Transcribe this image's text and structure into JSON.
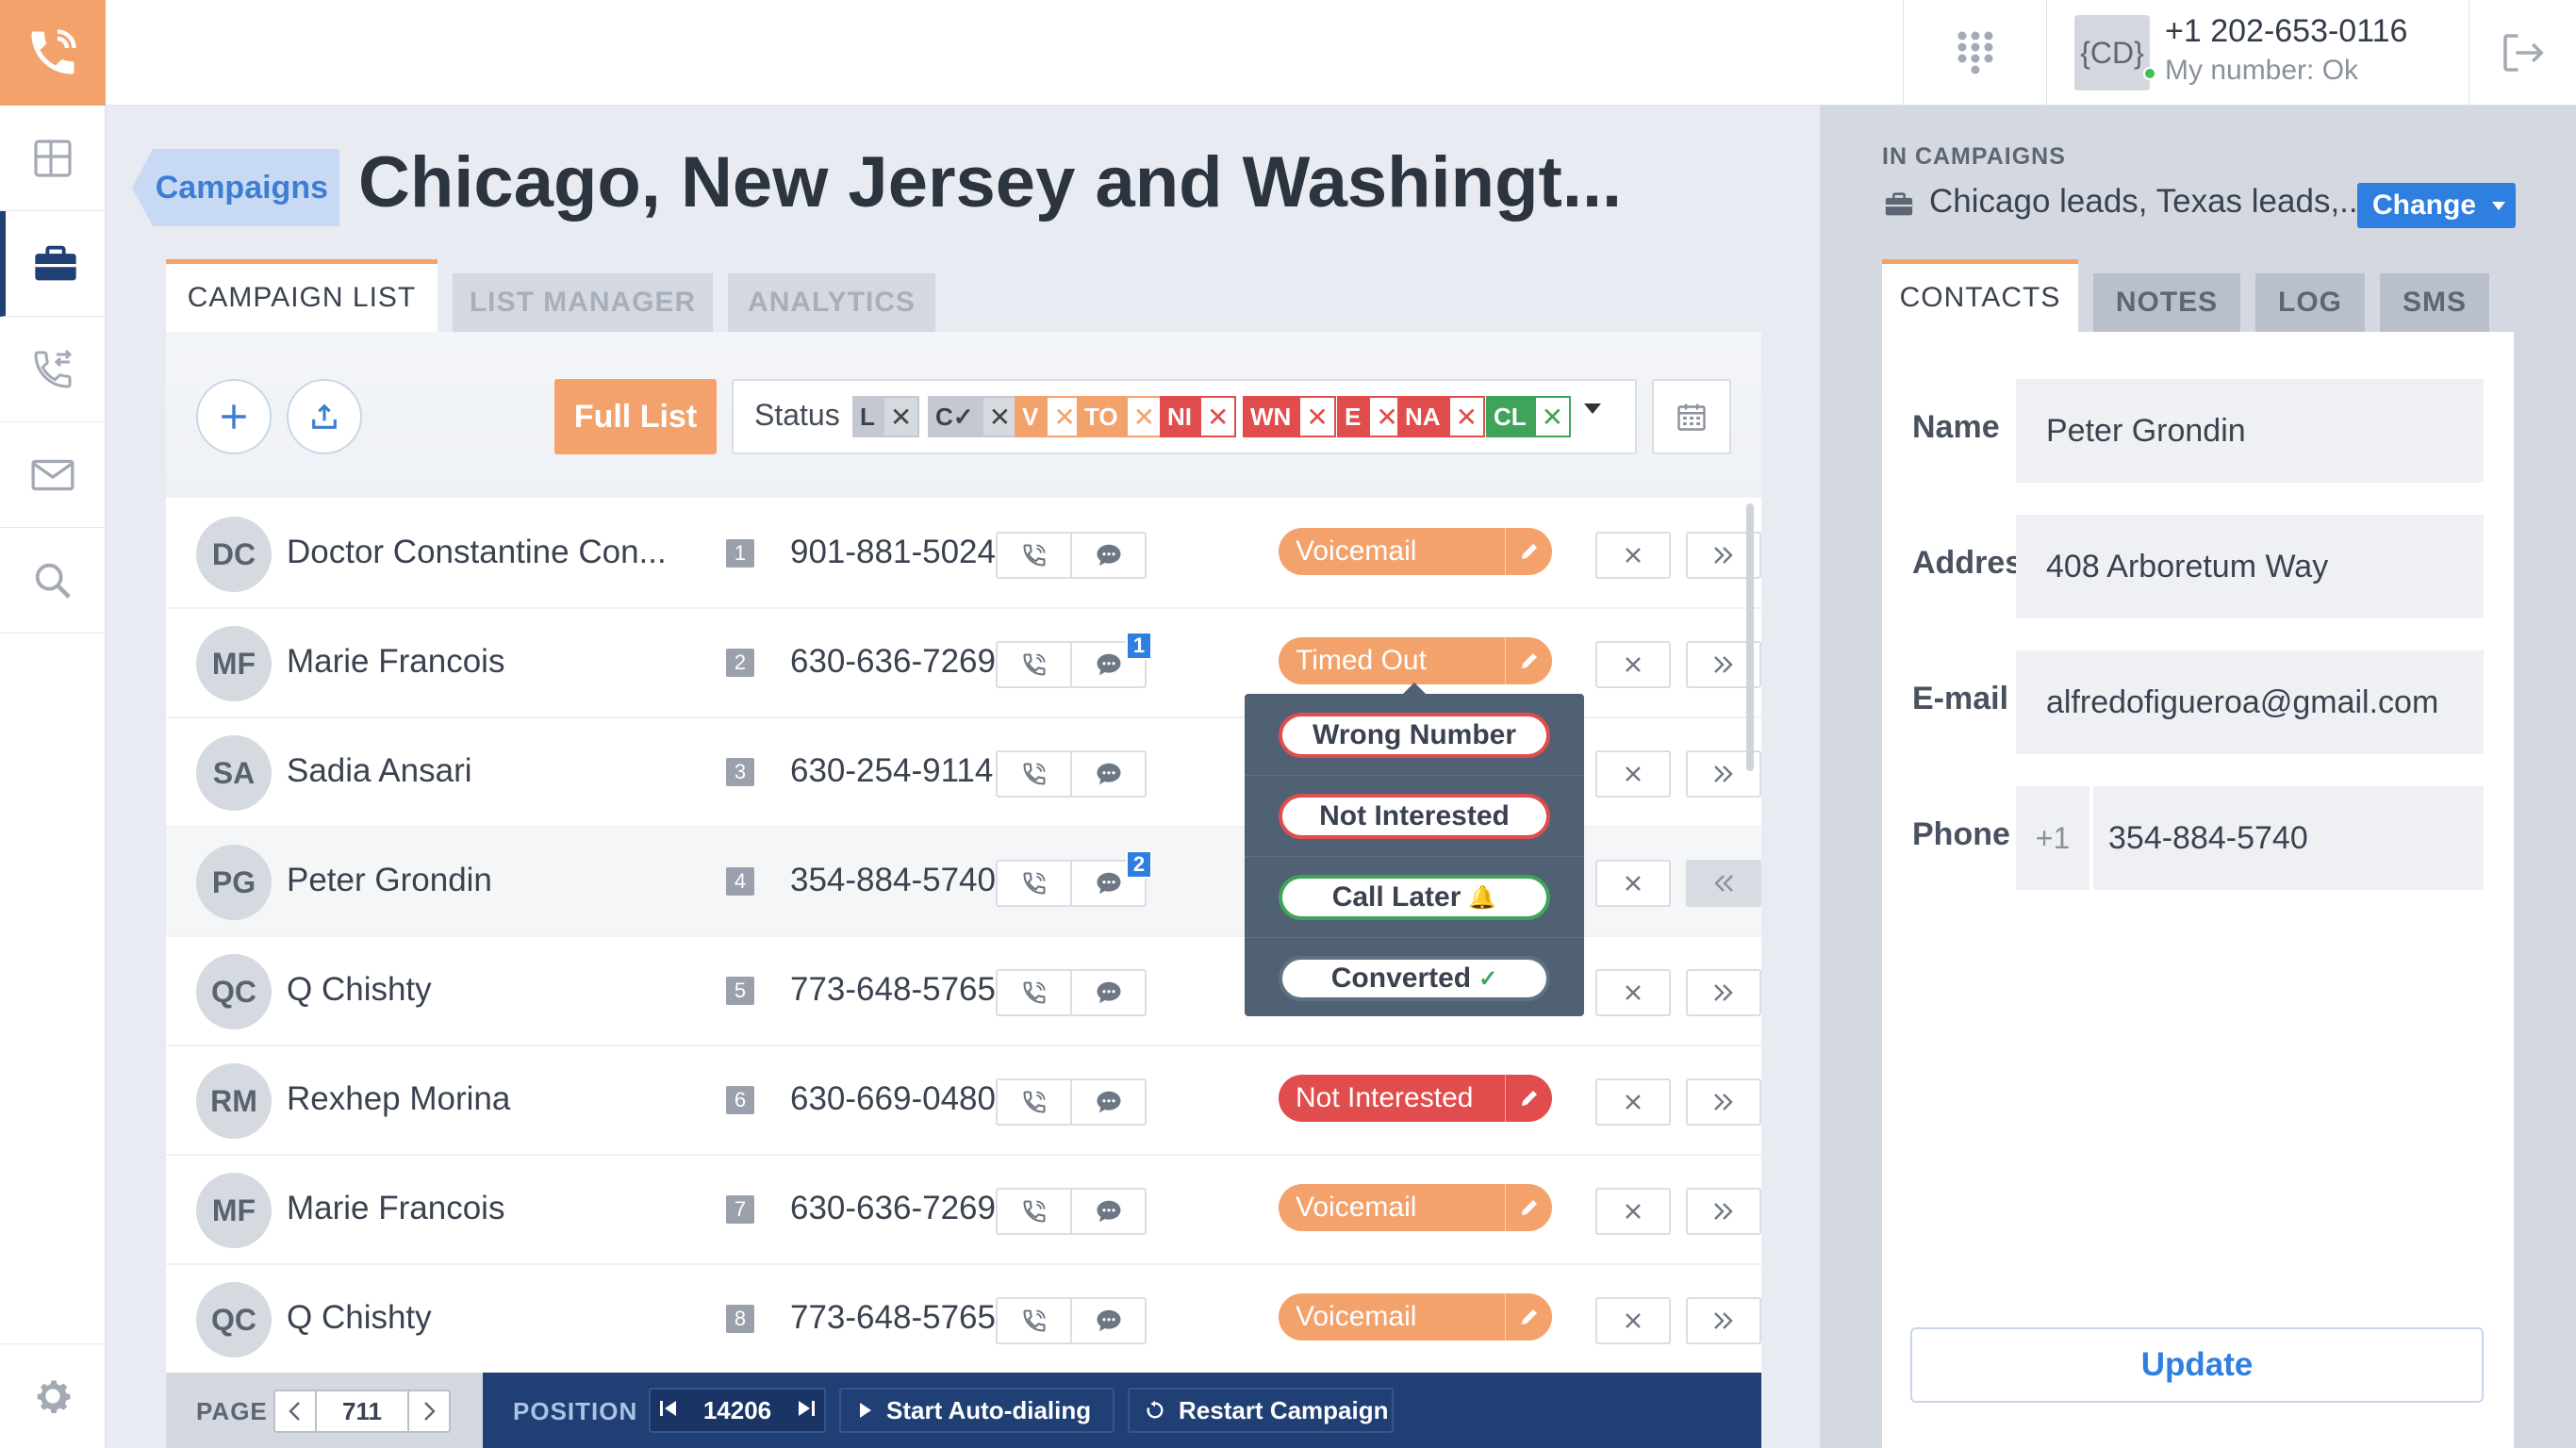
{
  "topbar": {
    "avatar_initials": "{CD}",
    "my_number": "+1 202-653-0116",
    "number_status": "My number: Ok"
  },
  "header": {
    "breadcrumb": "Campaigns",
    "title": "Chicago, New Jersey and Washingt..."
  },
  "tabs": [
    "CAMPAIGN LIST",
    "LIST MANAGER",
    "ANALYTICS"
  ],
  "toolbar": {
    "full_list": "Full List",
    "status_label": "Status"
  },
  "status_chips": [
    {
      "code": "L",
      "bg": "#c4c9d1",
      "color": "#3a4250"
    },
    {
      "code": "C✓",
      "bg": "#c4c9d1",
      "color": "#3a4250"
    },
    {
      "code": "V",
      "bg": "#f4a26c",
      "color": "#ffffff"
    },
    {
      "code": "TO",
      "bg": "#f4a26c",
      "color": "#ffffff"
    },
    {
      "code": "NI",
      "bg": "#e14c4c",
      "color": "#ffffff"
    },
    {
      "code": "WN",
      "bg": "#e14c4c",
      "color": "#ffffff"
    },
    {
      "code": "E",
      "bg": "#e14c4c",
      "color": "#ffffff"
    },
    {
      "code": "NA",
      "bg": "#e14c4c",
      "color": "#ffffff"
    },
    {
      "code": "CL",
      "bg": "#3fa45a",
      "color": "#ffffff"
    }
  ],
  "contacts": [
    {
      "initials": "DC",
      "name": "Doctor Constantine Con...",
      "num": "1",
      "phone": "901-881-5024",
      "status": "Voicemail",
      "status_color": "#f4a26c",
      "badge": "",
      "highlight": false
    },
    {
      "initials": "MF",
      "name": "Marie Francois",
      "num": "2",
      "phone": "630-636-7269",
      "status": "Timed Out",
      "status_color": "#f4a26c",
      "badge": "1",
      "highlight": false
    },
    {
      "initials": "SA",
      "name": "Sadia Ansari",
      "num": "3",
      "phone": "630-254-9114",
      "status": "",
      "status_color": "",
      "badge": "",
      "highlight": false
    },
    {
      "initials": "PG",
      "name": "Peter Grondin",
      "num": "4",
      "phone": "354-884-5740",
      "status": "",
      "status_color": "",
      "badge": "2",
      "highlight": true
    },
    {
      "initials": "QC",
      "name": "Q Chishty",
      "num": "5",
      "phone": "773-648-5765",
      "status": "",
      "status_color": "",
      "badge": "",
      "highlight": false
    },
    {
      "initials": "RM",
      "name": "Rexhep Morina",
      "num": "6",
      "phone": "630-669-0480",
      "status": "Not Interested",
      "status_color": "#e14c4c",
      "badge": "",
      "highlight": false
    },
    {
      "initials": "MF",
      "name": "Marie Francois",
      "num": "7",
      "phone": "630-636-7269",
      "status": "Voicemail",
      "status_color": "#f4a26c",
      "badge": "",
      "highlight": false
    },
    {
      "initials": "QC",
      "name": "Q Chishty",
      "num": "8",
      "phone": "773-648-5765",
      "status": "Voicemail",
      "status_color": "#f4a26c",
      "badge": "",
      "highlight": false
    }
  ],
  "status_menu": [
    {
      "label": "Wrong Number",
      "border": "#e14c4c",
      "suffix": ""
    },
    {
      "label": "Not Interested",
      "border": "#e14c4c",
      "suffix": ""
    },
    {
      "label": "Call Later",
      "border": "#3fa45a",
      "suffix": "🔔"
    },
    {
      "label": "Converted",
      "border": "#5f7182",
      "suffix": "✓"
    }
  ],
  "pager": {
    "page_label": "PAGE",
    "page": "711",
    "position_label": "POSITION",
    "position": "14206",
    "start_label": "Start Auto-dialing",
    "restart_label": "Restart Campaign"
  },
  "right": {
    "in_campaigns_label": "IN CAMPAIGNS",
    "in_campaigns": "Chicago leads, Texas leads,...",
    "change_label": "Change",
    "tabs": [
      "CONTACTS",
      "NOTES",
      "LOG",
      "SMS"
    ],
    "fields": [
      {
        "label": "Name",
        "value": "Peter Grondin"
      },
      {
        "label": "Addres",
        "value": "408 Arboretum Way"
      },
      {
        "label": "E-mail",
        "value": "alfredofigueroa@gmail.com"
      },
      {
        "label": "Phone",
        "value": "354-884-5740"
      }
    ],
    "phone_prefix": "+1",
    "update_label": "Update"
  }
}
